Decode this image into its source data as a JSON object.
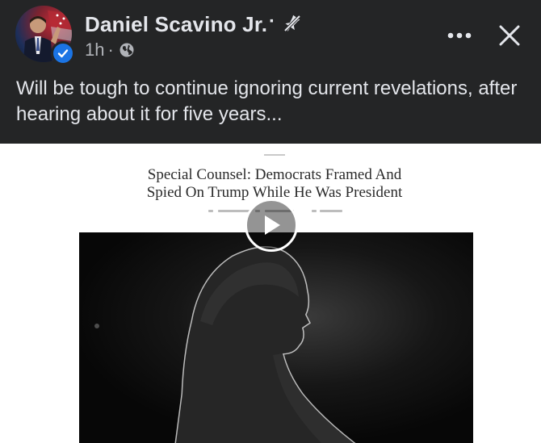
{
  "post": {
    "author_name": "Daniel Scavino Jr.",
    "name_separator": "·",
    "timestamp": "1h",
    "meta_separator": "·",
    "caption": "Will be tough to continue ignoring current revelations, after hearing about it for five years...",
    "icons": {
      "avatar": "profile-photo",
      "verified": "verified-check-icon",
      "unfollow": "unfollow-icon",
      "audience": "globe-icon",
      "more": "more-horizontal-icon",
      "close": "close-icon",
      "play": "play-icon"
    }
  },
  "media": {
    "type": "video",
    "article_headline_line1": "Special Counsel: Democrats Framed And",
    "article_headline_line2": "Spied On Trump While He Was President"
  },
  "colors": {
    "background": "#242526",
    "primary_text": "#e4e6eb",
    "secondary_text": "#b0b3b8",
    "verified_blue": "#1b74e4",
    "media_background": "#ffffff"
  }
}
